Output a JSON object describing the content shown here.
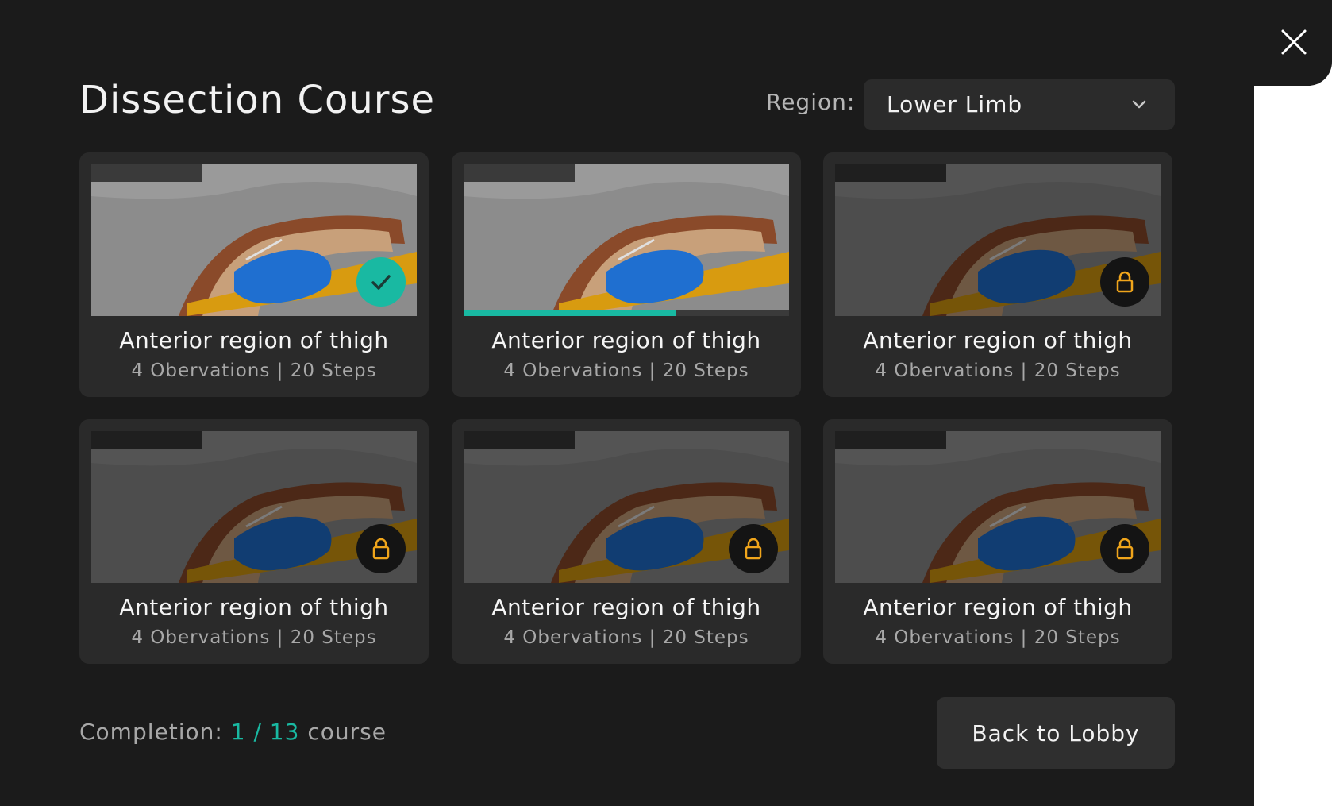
{
  "header": {
    "title": "Dissection Course",
    "region_label": "Region:",
    "region_value": "Lower Limb"
  },
  "cards": [
    {
      "title": "Anterior region of thigh",
      "subtitle": "4 Obervations | 20 Steps",
      "status": "completed",
      "progress": 1.0
    },
    {
      "title": "Anterior region of thigh",
      "subtitle": "4 Obervations | 20 Steps",
      "status": "in-progress",
      "progress": 0.65
    },
    {
      "title": "Anterior region of thigh",
      "subtitle": "4 Obervations | 20 Steps",
      "status": "locked",
      "progress": 0
    },
    {
      "title": "Anterior region of thigh",
      "subtitle": "4 Obervations | 20 Steps",
      "status": "locked",
      "progress": 0
    },
    {
      "title": "Anterior region of thigh",
      "subtitle": "4 Obervations | 20 Steps",
      "status": "locked",
      "progress": 0
    },
    {
      "title": "Anterior region of thigh",
      "subtitle": "4 Obervations | 20 Steps",
      "status": "locked",
      "progress": 0
    }
  ],
  "footer": {
    "completion_label": "Completion:",
    "completion_done": "1",
    "completion_sep": "/",
    "completion_total": "13",
    "completion_unit": "course",
    "back_button": "Back to Lobby"
  },
  "icons": {
    "close": "close-icon",
    "dropdown": "chevron-down-icon",
    "completed": "check-icon",
    "locked": "lock-icon"
  },
  "colors": {
    "accent": "#19b9a2",
    "lock": "#f0a51b",
    "panel": "#1b1b1b",
    "card": "#2a2a2a"
  }
}
